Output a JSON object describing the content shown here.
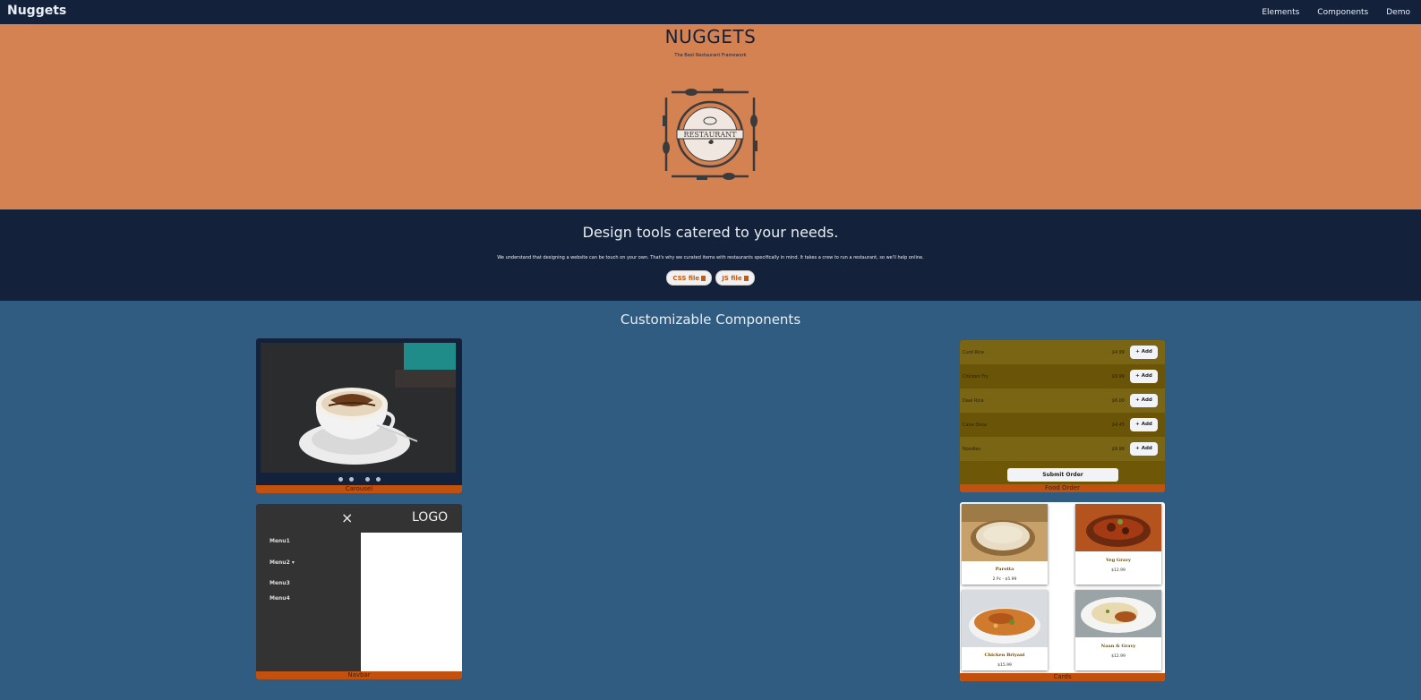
{
  "topnav": {
    "brand": "Nuggets",
    "links": [
      "Elements",
      "Components",
      "Demo"
    ]
  },
  "hero": {
    "title": "NUGGETS",
    "subtitle": "The Best Restaurant Framework",
    "logo_text": "RESTAURANT"
  },
  "band": {
    "title": "Design tools catered to your needs.",
    "text": "We understand that designing a website can be touch on your own. That's why we curated items with restaurants specifically in mind. It takes a crew to run a restaurant, so we'll help online.",
    "buttons": [
      "CSS file",
      "JS file"
    ]
  },
  "components": {
    "title": "Customizable Components",
    "carousel": {
      "label": "Carousel",
      "dots": 4
    },
    "food_order": {
      "label": "Food Order",
      "items": [
        {
          "name": "Curd Rice",
          "price": "$4.99",
          "button": "+ Add"
        },
        {
          "name": "Chicken Fry",
          "price": "$9.99",
          "button": "+ Add"
        },
        {
          "name": "Daal Rice",
          "price": "$6.00",
          "button": "+ Add"
        },
        {
          "name": "Cane Dosa",
          "price": "$4.45",
          "button": "+ Add"
        },
        {
          "name": "Noodles",
          "price": "$9.99",
          "button": "+ Add"
        }
      ],
      "submit": "Submit Order"
    },
    "navbar": {
      "label": "Navbar",
      "close": "×",
      "logo": "LOGO",
      "menus": [
        "Menu1",
        "Menu2 ▾",
        "Menu3",
        "Menu4"
      ]
    },
    "cards": {
      "label": "Cards",
      "items": [
        {
          "name": "Parotta",
          "price": "2 Pc - $5.99"
        },
        {
          "name": "Veg Gravy",
          "price": "$12.99"
        },
        {
          "name": "Chicken Briyani",
          "price": "$15.99"
        },
        {
          "name": "Naan & Gravy",
          "price": "$12.99"
        }
      ]
    }
  },
  "colors": {
    "nav": "#13213a",
    "hero": "#d58253",
    "section": "#2f5c80",
    "accent": "#c2510f"
  }
}
